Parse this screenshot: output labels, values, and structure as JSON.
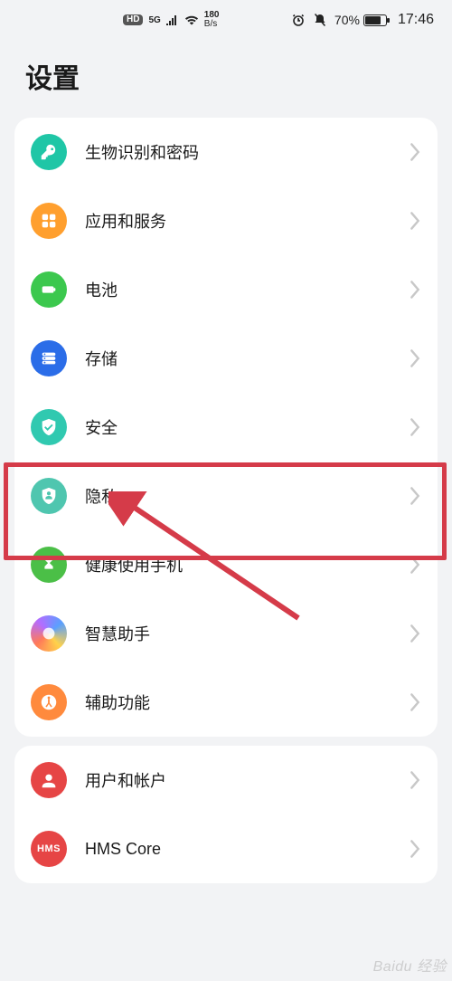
{
  "status": {
    "hd_badge": "HD",
    "network_type": "5G",
    "net_speed_value": "180",
    "net_speed_unit": "B/s",
    "battery_percent": "70%",
    "time": "17:46"
  },
  "header": {
    "title": "设置"
  },
  "groups": [
    {
      "items": [
        {
          "icon": "key-icon",
          "color": "c-teal",
          "label": "生物识别和密码"
        },
        {
          "icon": "apps-icon",
          "color": "c-orange",
          "label": "应用和服务"
        },
        {
          "icon": "battery-icon",
          "color": "c-green",
          "label": "电池"
        },
        {
          "icon": "storage-icon",
          "color": "c-blue",
          "label": "存储"
        },
        {
          "icon": "shield-icon",
          "color": "c-teal2",
          "label": "安全"
        },
        {
          "icon": "privacy-icon",
          "color": "c-teal3",
          "label": "隐私"
        },
        {
          "icon": "hourglass-icon",
          "color": "c-green2",
          "label": "健康使用手机"
        },
        {
          "icon": "assistant-icon",
          "color": "c-gradient",
          "label": "智慧助手"
        },
        {
          "icon": "accessibility-icon",
          "color": "c-orange2",
          "label": "辅助功能"
        }
      ]
    },
    {
      "items": [
        {
          "icon": "user-icon",
          "color": "c-red",
          "label": "用户和帐户"
        },
        {
          "icon": "hms-icon",
          "color": "c-hms",
          "label": "HMS Core",
          "icon_text": "HMS"
        }
      ]
    }
  ],
  "annotations": {
    "highlight_target_label": "隐私",
    "highlight_color": "#d53b49"
  },
  "watermark": "Baidu 经验"
}
